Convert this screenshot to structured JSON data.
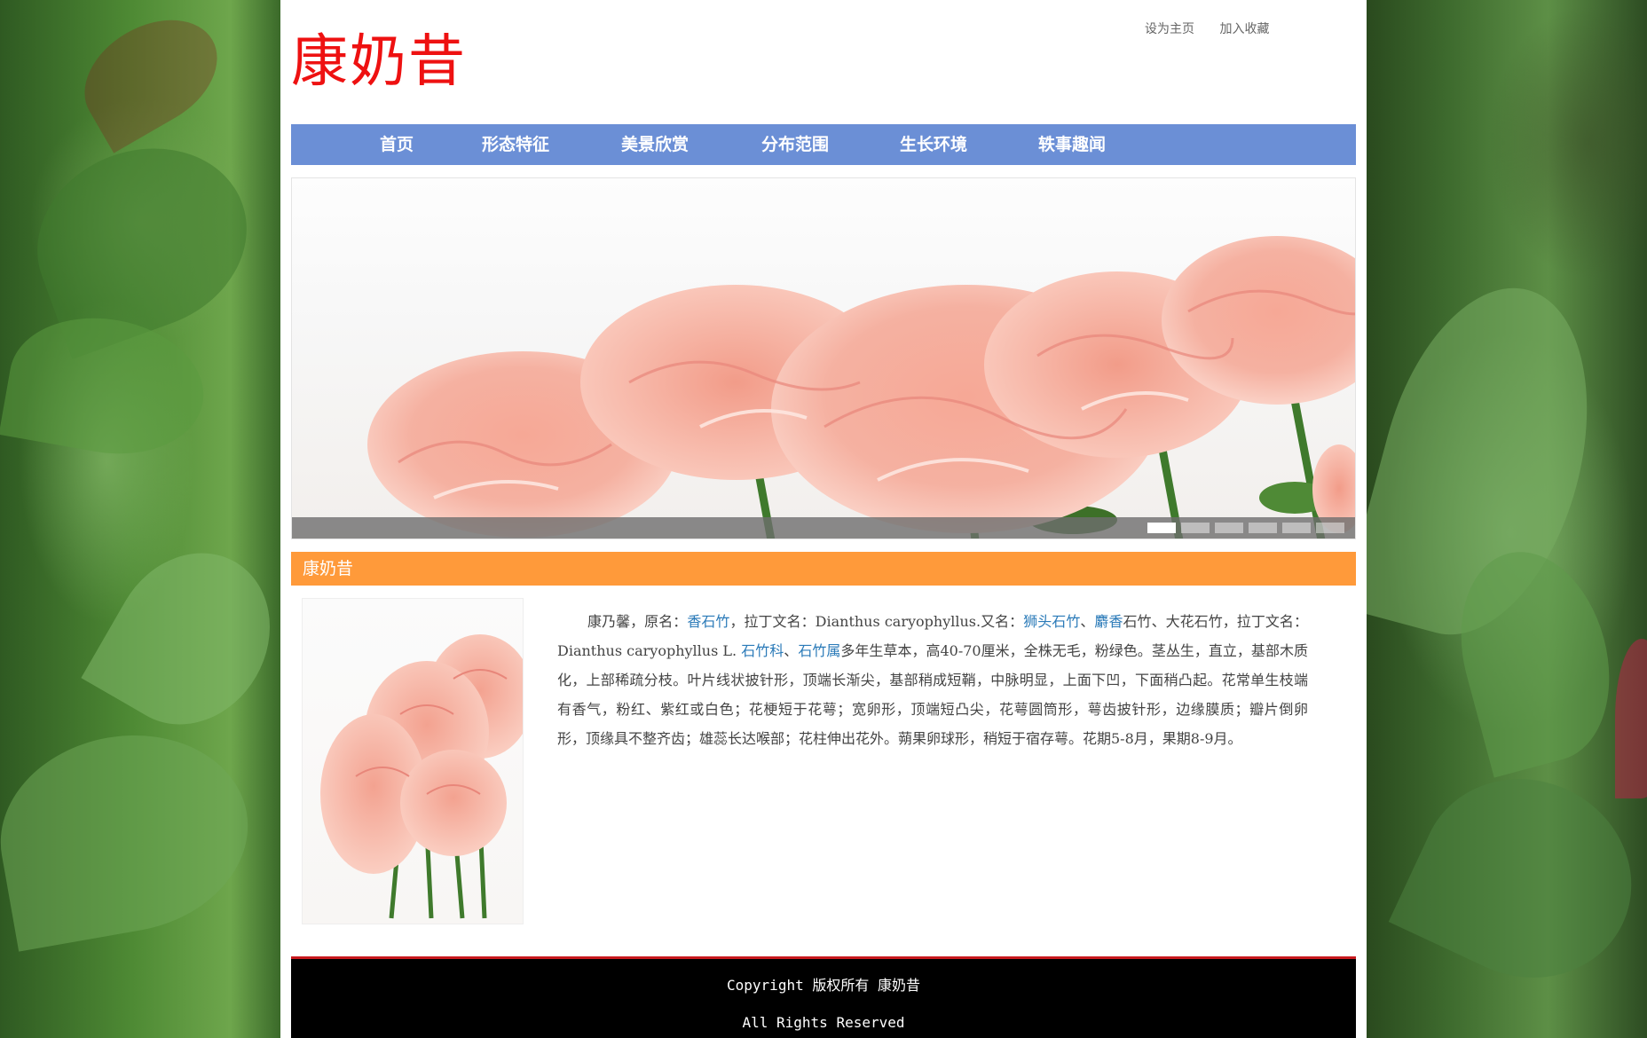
{
  "header": {
    "logo": "康奶昔",
    "set_home": "设为主页",
    "add_favorite": "加入收藏"
  },
  "nav": {
    "items": [
      {
        "label": "首页"
      },
      {
        "label": "形态特征"
      },
      {
        "label": "美景欣赏"
      },
      {
        "label": "分布范围"
      },
      {
        "label": "生长环境"
      },
      {
        "label": "轶事趣闻"
      }
    ]
  },
  "banner": {
    "slide_count": 6,
    "active_slide": 1
  },
  "section": {
    "title": "康奶昔"
  },
  "article": {
    "p1": "康乃馨，原名：",
    "link1": "香石竹",
    "p2": "，拉丁文名：Dianthus caryophyllus.又名：",
    "link2": "狮头石竹",
    "p3": "、",
    "link3": "麝香",
    "p4": "石竹、大花石竹，拉丁文名：Dianthus caryophyllus L. ",
    "link4": "石竹科",
    "p5": "、",
    "link5": "石竹属",
    "p6": "多年生草本，高40-70厘米，全株无毛，粉绿色。茎丛生，直立，基部木质化，上部稀疏分枝。叶片线状披针形，顶端长渐尖，基部稍成短鞘，中脉明显，上面下凹，下面稍凸起。花常单生枝端有香气，粉红、紫红或白色；花梗短于花萼；宽卵形，顶端短凸尖，花萼圆筒形，萼齿披针形，边缘膜质；瓣片倒卵形，顶缘具不整齐齿；雄蕊长达喉部；花柱伸出花外。蒴果卵球形，稍短于宿存萼。花期5-8月，果期8-9月。"
  },
  "footer": {
    "line1": "Copyright 版权所有 康奶昔",
    "line2": "All Rights Reserved"
  },
  "colors": {
    "logo": "#ee1111",
    "nav_bg": "#6b8fd6",
    "section_bar": "#ff9a3a",
    "link": "#2a7ab8",
    "footer_bg": "#000000",
    "footer_border": "#c8191e"
  }
}
